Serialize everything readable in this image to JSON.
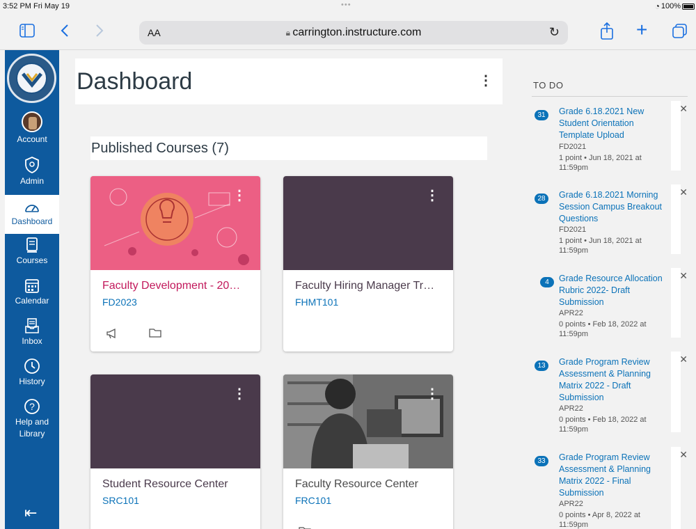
{
  "status": {
    "time": "3:52 PM  Fri May 19",
    "dots": "•••",
    "battery": "100%"
  },
  "browser": {
    "aa": "AA",
    "url": "carrington.instructure.com"
  },
  "sidebar": {
    "items": [
      {
        "label": "Account"
      },
      {
        "label": "Admin"
      },
      {
        "label": "Dashboard"
      },
      {
        "label": "Courses"
      },
      {
        "label": "Calendar"
      },
      {
        "label": "Inbox"
      },
      {
        "label": "History"
      },
      {
        "label": "Help and\nLibrary"
      }
    ]
  },
  "header": {
    "title": "Dashboard"
  },
  "published": {
    "title": "Published Courses (7)"
  },
  "cards": [
    {
      "name": "Faculty Development - 20…",
      "code": "FD2023",
      "color": "#c2185b"
    },
    {
      "name": "Faculty Hiring Manager Tr…",
      "code": "FHMT101",
      "color": "#4a3a4b"
    },
    {
      "name": "Student Resource Center",
      "code": "SRC101",
      "color": "#4a3a4b"
    },
    {
      "name": "Faculty Resource Center",
      "code": "FRC101",
      "color": "#5a5a5a"
    }
  ],
  "todo": {
    "title": "TO DO",
    "items": [
      {
        "badge": "31",
        "title": "Grade 6.18.2021 New Student Orientation Template Upload",
        "course": "FD2021",
        "meta": "1 point • Jun 18, 2021 at 11:59pm"
      },
      {
        "badge": "28",
        "title": "Grade 6.18.2021 Morning Session Campus Breakout Questions",
        "course": "FD2021",
        "meta": "1 point • Jun 18, 2021 at 11:59pm"
      },
      {
        "badge": "4",
        "title": "Grade Resource Allocation Rubric 2022- Draft Submission",
        "course": "APR22",
        "meta": "0 points • Feb 18, 2022 at 11:59pm"
      },
      {
        "badge": "13",
        "title": "Grade Program Review Assessment & Planning Matrix 2022 - Draft Submission",
        "course": "APR22",
        "meta": "0 points • Feb 18, 2022 at 11:59pm"
      },
      {
        "badge": "33",
        "title": "Grade Program Review Assessment & Planning Matrix 2022 - Final Submission",
        "course": "APR22",
        "meta": "0 points • Apr 8, 2022 at 11:59pm"
      }
    ]
  },
  "colors": {
    "brand": "#0e5a9e",
    "link": "#0b72b8",
    "card_pink": "#e8547a",
    "card_plum": "#4a3a4b"
  }
}
